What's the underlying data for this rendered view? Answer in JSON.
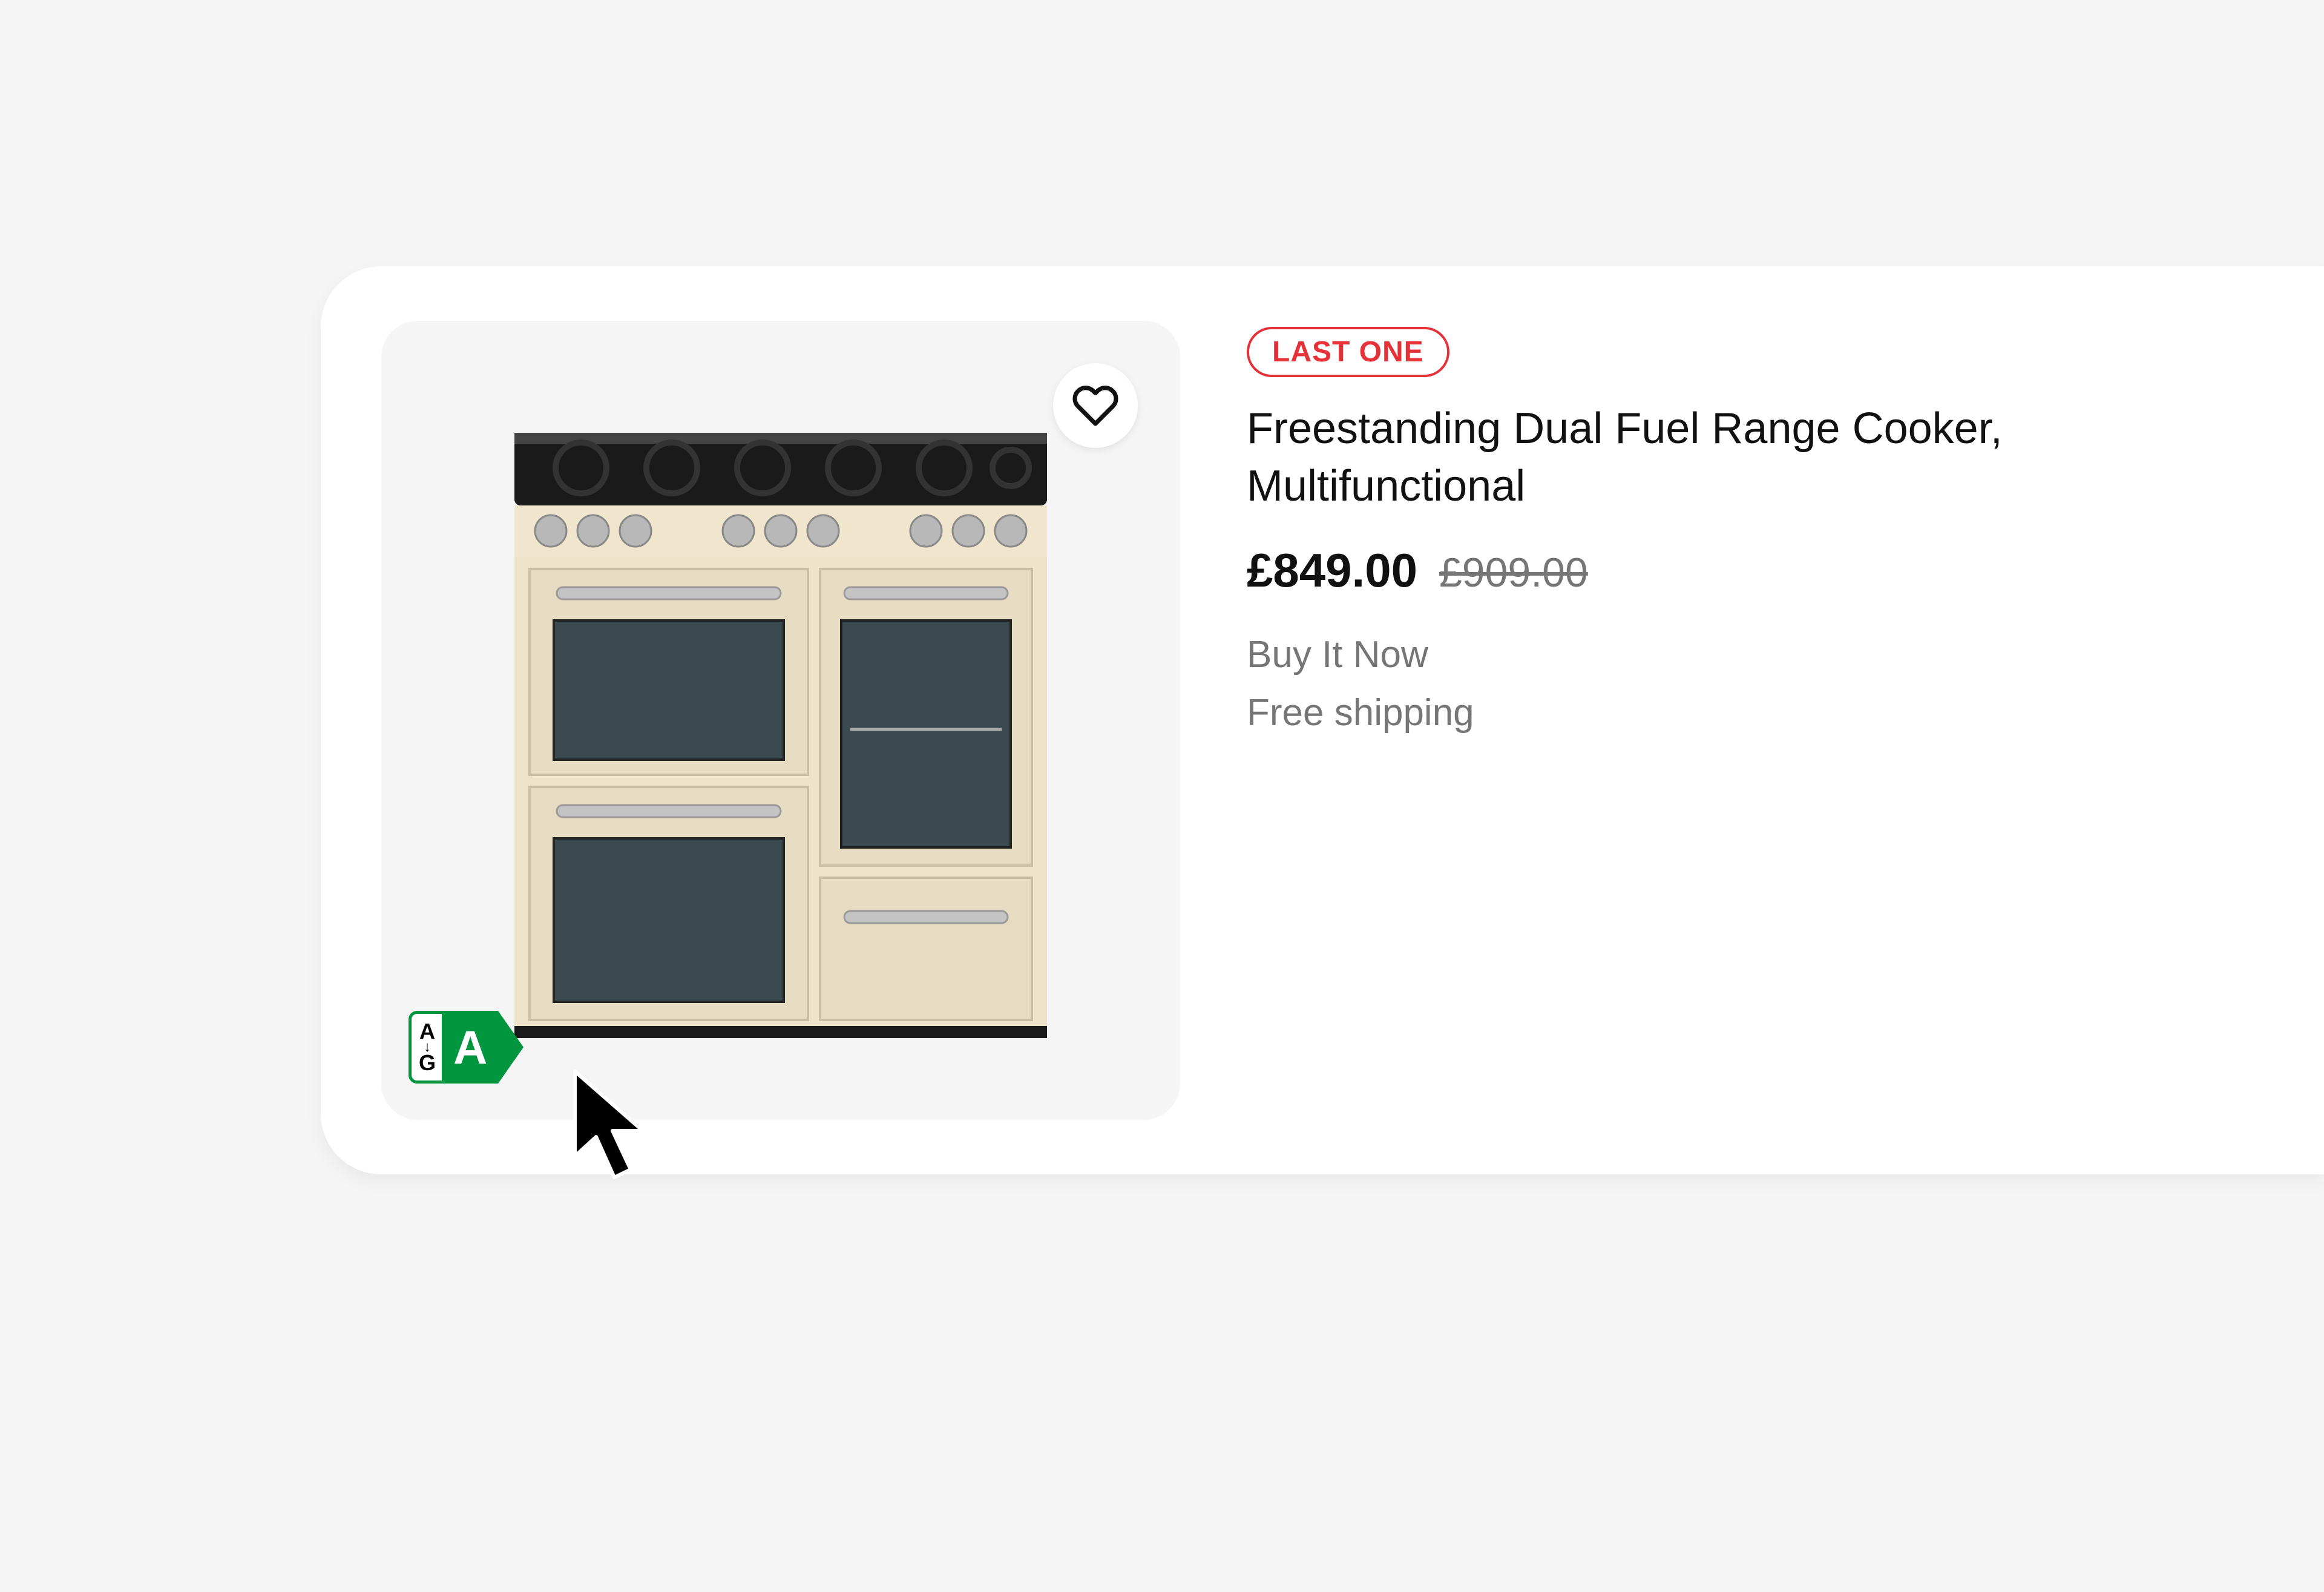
{
  "product": {
    "badge": "LAST ONE",
    "title": "Freestanding Dual Fuel Range Cooker, Multifunctional",
    "price": "£849.00",
    "original_price": "£909.00",
    "buy_type": "Buy It Now",
    "shipping": "Free shipping",
    "energy": {
      "scale_top": "A",
      "scale_bottom": "G",
      "grade": "A",
      "color": "#009640"
    }
  }
}
